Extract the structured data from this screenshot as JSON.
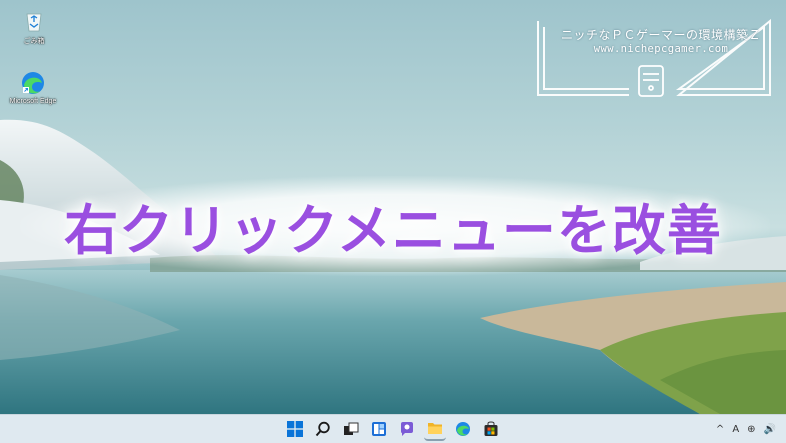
{
  "desktop": {
    "icons": [
      {
        "label": "ごみ箱",
        "icon": "recycle-bin-icon"
      },
      {
        "label": "Microsoft Edge",
        "icon": "edge-icon"
      }
    ]
  },
  "watermark": {
    "line1": "ニッチなＰＣゲーマーの環境構築Ｚ",
    "line2": "www.nichepcgamer.com"
  },
  "headline": "右クリックメニューを改善",
  "colors": {
    "headline": "#9a4fe0",
    "taskbar": "#dfe9f0",
    "windows_blue": "#0a74d8"
  },
  "taskbar": {
    "apps": [
      "start-icon",
      "search-icon",
      "task-view-icon",
      "widgets-icon",
      "chat-icon",
      "file-explorer-icon",
      "edge-icon",
      "store-icon"
    ],
    "tray": {
      "chevron": "^",
      "ime": "A",
      "network": "⊕",
      "volume": "🔊"
    }
  }
}
